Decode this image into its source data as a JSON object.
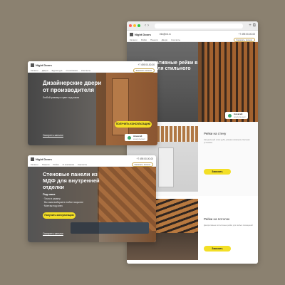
{
  "colors": {
    "background": "#8b8170",
    "accent": "#f3df26",
    "wood": "#a86a3a",
    "green": "#3aa76d"
  },
  "browser": {
    "url": "",
    "brand": "Night Doors",
    "phone": "+7 495 00-00-00",
    "email": "info@nd.ru",
    "menu": [
      "Каталог",
      "Рейки",
      "Панели",
      "Двери",
      "Контакты"
    ],
    "callback": "Заказать звонок",
    "hero_title": "Декоративные рейки в дубе для стильного",
    "consult_name": "Алексей",
    "consult_role": "консультант",
    "section1_title": "Рейки на стену",
    "section1_text": "Натуральный шпон дуба, ровная геометрия, быстрая установка",
    "section1_btn": "Заказать",
    "section2_title": "Рейки на потолок",
    "section2_text": "Декоративные потолочные рейки для любых помещений",
    "section2_btn": "Заказать"
  },
  "doors": {
    "brand": "Night Doors",
    "phone": "+7 495 00-00-00",
    "menu": [
      "Каталог",
      "Двери",
      "Фурнитура",
      "О компании",
      "Контакты"
    ],
    "callback": "Заказать звонок",
    "hero_title_1": "Дизайнерские двери",
    "hero_title_2": "от производителя",
    "hero_sub": "Любой размер и цвет под заказ",
    "cta": "ПОЛУЧИТЬ КОНСУЛЬТАЦИЮ",
    "link": "Смотреть каталог",
    "consult_name": "Алексей",
    "consult_role": "консультант"
  },
  "panels": {
    "brand": "Night Doors",
    "phone": "+7 495 00-00-00",
    "menu": [
      "Каталог",
      "Панели",
      "Рейки",
      "О компании",
      "Контакты"
    ],
    "callback": "Заказать звонок",
    "hero_title_1": "Стеновые панели из",
    "hero_title_2": "МДФ для внутренней",
    "hero_title_3": "отделки",
    "list_title": "Под заказ",
    "list": [
      "Точно в размер",
      "Вы сами выбираете любое покрытие",
      "Монтаж под ключ"
    ],
    "cta": "Получить консультацию",
    "link": "Смотреть каталог"
  }
}
